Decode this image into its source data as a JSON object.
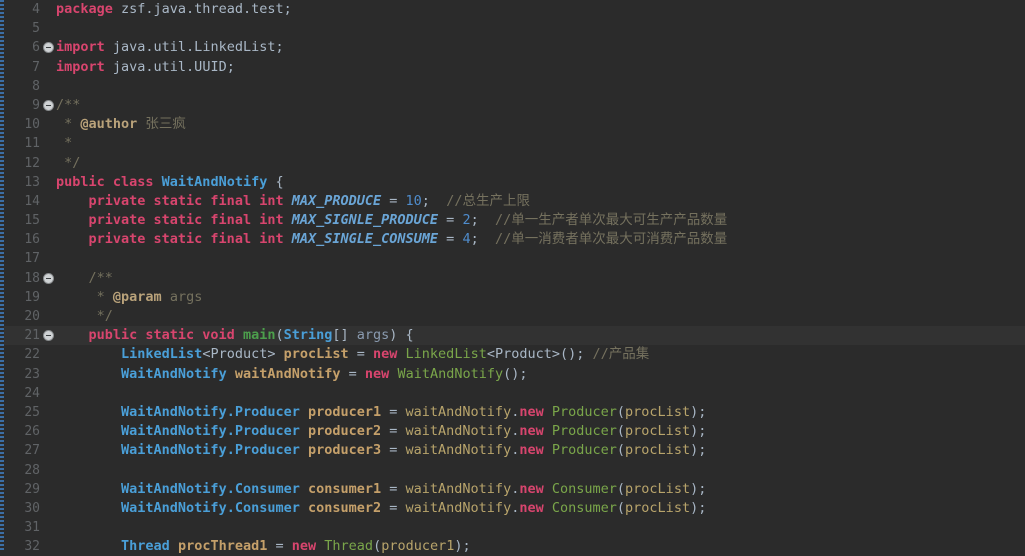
{
  "editor": {
    "app": "java-code-editor",
    "theme": "darcula",
    "colors": {
      "background": "#2b2b2b",
      "current_line": "#323232",
      "gutter_text": "#606366",
      "default_text": "#a9b7c6",
      "keyword": "#d8456e",
      "class_name": "#4a9fd8",
      "constant": "#6aa5d6",
      "number": "#4f8ccc",
      "comment": "#75715e",
      "javadoc_tag": "#b9a27a",
      "constructor": "#7aa64a",
      "method": "#4c9f4c",
      "local_var": "#c5a06a",
      "change_bar": "#3b6ea5"
    },
    "current_line_number": 21,
    "first_visible_line": 4,
    "last_visible_line": 32,
    "fold_markers": [
      6,
      9,
      18,
      21
    ],
    "lines": [
      {
        "n": 4,
        "text": "package zsf.java.thread.test;"
      },
      {
        "n": 5,
        "text": ""
      },
      {
        "n": 6,
        "text": "import java.util.LinkedList;"
      },
      {
        "n": 7,
        "text": "import java.util.UUID;"
      },
      {
        "n": 8,
        "text": ""
      },
      {
        "n": 9,
        "text": "/**"
      },
      {
        "n": 10,
        "text": " * @author 张三疯"
      },
      {
        "n": 11,
        "text": " *"
      },
      {
        "n": 12,
        "text": " */"
      },
      {
        "n": 13,
        "text": "public class WaitAndNotify {"
      },
      {
        "n": 14,
        "text": "    private static final int MAX_PRODUCE = 10; //总生产上限"
      },
      {
        "n": 15,
        "text": "    private static final int MAX_SIGNLE_PRODUCE = 2; //单一生产者单次最大可生产产品数量"
      },
      {
        "n": 16,
        "text": "    private static final int MAX_SINGLE_CONSUME = 4; //单一消费者单次最大可消费产品数量"
      },
      {
        "n": 17,
        "text": ""
      },
      {
        "n": 18,
        "text": "    /**"
      },
      {
        "n": 19,
        "text": "     * @param args"
      },
      {
        "n": 20,
        "text": "     */"
      },
      {
        "n": 21,
        "text": "    public static void main(String[] args) {"
      },
      {
        "n": 22,
        "text": "        LinkedList<Product> procList = new LinkedList<Product>(); //产品集"
      },
      {
        "n": 23,
        "text": "        WaitAndNotify waitAndNotify = new WaitAndNotify();"
      },
      {
        "n": 24,
        "text": ""
      },
      {
        "n": 25,
        "text": "        WaitAndNotify.Producer producer1 = waitAndNotify.new Producer(procList);"
      },
      {
        "n": 26,
        "text": "        WaitAndNotify.Producer producer2 = waitAndNotify.new Producer(procList);"
      },
      {
        "n": 27,
        "text": "        WaitAndNotify.Producer producer3 = waitAndNotify.new Producer(procList);"
      },
      {
        "n": 28,
        "text": ""
      },
      {
        "n": 29,
        "text": "        WaitAndNotify.Consumer consumer1 = waitAndNotify.new Consumer(procList);"
      },
      {
        "n": 30,
        "text": "        WaitAndNotify.Consumer consumer2 = waitAndNotify.new Consumer(procList);"
      },
      {
        "n": 31,
        "text": ""
      },
      {
        "n": 32,
        "text": "        Thread procThread1 = new Thread(producer1);"
      }
    ],
    "tokens": {
      "l4": [
        [
          "kw",
          "package"
        ],
        [
          "plain",
          " zsf.java.thread.test;"
        ]
      ],
      "l6": [
        [
          "kw",
          "import"
        ],
        [
          "plain",
          " java.util.LinkedList;"
        ]
      ],
      "l7": [
        [
          "kw",
          "import"
        ],
        [
          "plain",
          " java.util.UUID;"
        ]
      ],
      "l9": [
        [
          "cmt",
          "/**"
        ]
      ],
      "l10": [
        [
          "cmt",
          " * "
        ],
        [
          "tag",
          "@author"
        ],
        [
          "cmt",
          " 张三疯"
        ]
      ],
      "l11": [
        [
          "cmt",
          " *"
        ]
      ],
      "l12": [
        [
          "cmt",
          " */"
        ]
      ],
      "l13": [
        [
          "kw",
          "public class "
        ],
        [
          "type",
          "WaitAndNotify"
        ],
        [
          "plain",
          " {"
        ]
      ],
      "l14": [
        [
          "plain",
          "    "
        ],
        [
          "kw",
          "private static final int"
        ],
        [
          "plain",
          " "
        ],
        [
          "const",
          "MAX_PRODUCE"
        ],
        [
          "plain",
          " = "
        ],
        [
          "num",
          "10"
        ],
        [
          "plain",
          ";  "
        ],
        [
          "cmt",
          "//总生产上限"
        ]
      ],
      "l15": [
        [
          "plain",
          "    "
        ],
        [
          "kw",
          "private static final int"
        ],
        [
          "plain",
          " "
        ],
        [
          "const",
          "MAX_SIGNLE_PRODUCE"
        ],
        [
          "plain",
          " = "
        ],
        [
          "num",
          "2"
        ],
        [
          "plain",
          ";  "
        ],
        [
          "cmt",
          "//单一生产者单次最大可生产产品数量"
        ]
      ],
      "l16": [
        [
          "plain",
          "    "
        ],
        [
          "kw",
          "private static final int"
        ],
        [
          "plain",
          " "
        ],
        [
          "const",
          "MAX_SINGLE_CONSUME"
        ],
        [
          "plain",
          " = "
        ],
        [
          "num",
          "4"
        ],
        [
          "plain",
          ";  "
        ],
        [
          "cmt",
          "//单一消费者单次最大可消费产品数量"
        ]
      ],
      "l18": [
        [
          "cmt",
          "    /**"
        ]
      ],
      "l19": [
        [
          "cmt",
          "     * "
        ],
        [
          "tag",
          "@param"
        ],
        [
          "cmt",
          " args"
        ]
      ],
      "l20": [
        [
          "cmt",
          "     */"
        ]
      ],
      "l21": [
        [
          "plain",
          "    "
        ],
        [
          "kw",
          "public static void "
        ],
        [
          "meth",
          "main"
        ],
        [
          "punct",
          "("
        ],
        [
          "type",
          "String"
        ],
        [
          "punct",
          "[] "
        ],
        [
          "param",
          "args"
        ],
        [
          "punct",
          ") {"
        ]
      ],
      "l22": [
        [
          "plain",
          "        "
        ],
        [
          "type",
          "LinkedList"
        ],
        [
          "gen",
          "<Product> "
        ],
        [
          "local",
          "procList"
        ],
        [
          "plain",
          " = "
        ],
        [
          "kw",
          "new"
        ],
        [
          "plain",
          " "
        ],
        [
          "ctor",
          "LinkedList"
        ],
        [
          "gen",
          "<Product>"
        ],
        [
          "punct",
          "(); "
        ],
        [
          "cmt",
          "//产品集"
        ]
      ],
      "l23": [
        [
          "plain",
          "        "
        ],
        [
          "type",
          "WaitAndNotify"
        ],
        [
          "plain",
          " "
        ],
        [
          "local",
          "waitAndNotify"
        ],
        [
          "plain",
          " = "
        ],
        [
          "kw",
          "new"
        ],
        [
          "plain",
          " "
        ],
        [
          "ctor",
          "WaitAndNotify"
        ],
        [
          "punct",
          "();"
        ]
      ],
      "l25": [
        [
          "plain",
          "        "
        ],
        [
          "type",
          "WaitAndNotify.Producer"
        ],
        [
          "plain",
          " "
        ],
        [
          "local",
          "producer1"
        ],
        [
          "plain",
          " = "
        ],
        [
          "var",
          "waitAndNotify"
        ],
        [
          "punct",
          "."
        ],
        [
          "kw",
          "new"
        ],
        [
          "plain",
          " "
        ],
        [
          "ctor",
          "Producer"
        ],
        [
          "punct",
          "("
        ],
        [
          "var",
          "procList"
        ],
        [
          "punct",
          ");"
        ]
      ],
      "l26": [
        [
          "plain",
          "        "
        ],
        [
          "type",
          "WaitAndNotify.Producer"
        ],
        [
          "plain",
          " "
        ],
        [
          "local",
          "producer2"
        ],
        [
          "plain",
          " = "
        ],
        [
          "var",
          "waitAndNotify"
        ],
        [
          "punct",
          "."
        ],
        [
          "kw",
          "new"
        ],
        [
          "plain",
          " "
        ],
        [
          "ctor",
          "Producer"
        ],
        [
          "punct",
          "("
        ],
        [
          "var",
          "procList"
        ],
        [
          "punct",
          ");"
        ]
      ],
      "l27": [
        [
          "plain",
          "        "
        ],
        [
          "type",
          "WaitAndNotify.Producer"
        ],
        [
          "plain",
          " "
        ],
        [
          "local",
          "producer3"
        ],
        [
          "plain",
          " = "
        ],
        [
          "var",
          "waitAndNotify"
        ],
        [
          "punct",
          "."
        ],
        [
          "kw",
          "new"
        ],
        [
          "plain",
          " "
        ],
        [
          "ctor",
          "Producer"
        ],
        [
          "punct",
          "("
        ],
        [
          "var",
          "procList"
        ],
        [
          "punct",
          ");"
        ]
      ],
      "l29": [
        [
          "plain",
          "        "
        ],
        [
          "type",
          "WaitAndNotify.Consumer"
        ],
        [
          "plain",
          " "
        ],
        [
          "local",
          "consumer1"
        ],
        [
          "plain",
          " = "
        ],
        [
          "var",
          "waitAndNotify"
        ],
        [
          "punct",
          "."
        ],
        [
          "kw",
          "new"
        ],
        [
          "plain",
          " "
        ],
        [
          "ctor",
          "Consumer"
        ],
        [
          "punct",
          "("
        ],
        [
          "var",
          "procList"
        ],
        [
          "punct",
          ");"
        ]
      ],
      "l30": [
        [
          "plain",
          "        "
        ],
        [
          "type",
          "WaitAndNotify.Consumer"
        ],
        [
          "plain",
          " "
        ],
        [
          "local",
          "consumer2"
        ],
        [
          "plain",
          " = "
        ],
        [
          "var",
          "waitAndNotify"
        ],
        [
          "punct",
          "."
        ],
        [
          "kw",
          "new"
        ],
        [
          "plain",
          " "
        ],
        [
          "ctor",
          "Consumer"
        ],
        [
          "punct",
          "("
        ],
        [
          "var",
          "procList"
        ],
        [
          "punct",
          ");"
        ]
      ],
      "l32": [
        [
          "plain",
          "        "
        ],
        [
          "type",
          "Thread"
        ],
        [
          "plain",
          " "
        ],
        [
          "local",
          "procThread1"
        ],
        [
          "plain",
          " = "
        ],
        [
          "kw",
          "new"
        ],
        [
          "plain",
          " "
        ],
        [
          "ctor",
          "Thread"
        ],
        [
          "punct",
          "("
        ],
        [
          "var",
          "producer1"
        ],
        [
          "punct",
          ");"
        ]
      ]
    }
  }
}
